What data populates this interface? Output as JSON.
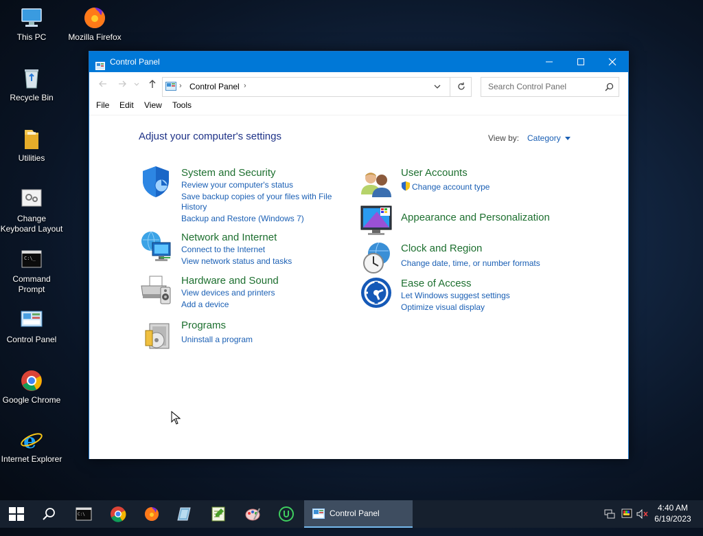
{
  "desktop": {
    "icons": [
      {
        "label": "This PC"
      },
      {
        "label": "Mozilla Firefox"
      },
      {
        "label": "Recycle Bin"
      },
      {
        "label": "Utilities"
      },
      {
        "label": "Change\nKeyboard Layout"
      },
      {
        "label": "Command\nPrompt"
      },
      {
        "label": "Control Panel"
      },
      {
        "label": "Google Chrome"
      },
      {
        "label": "Internet Explorer"
      }
    ]
  },
  "window": {
    "title": "Control Panel",
    "address": {
      "crumb": "Control Panel"
    },
    "search": {
      "placeholder": "Search Control Panel"
    },
    "menu": [
      "File",
      "Edit",
      "View",
      "Tools"
    ]
  },
  "content": {
    "heading": "Adjust your computer's settings",
    "view_by_label": "View by:",
    "view_by_value": "Category",
    "categories": [
      {
        "title": "System and Security",
        "links": [
          "Review your computer's status",
          "Save backup copies of your files with File",
          "History",
          "Backup and Restore (Windows 7)"
        ]
      },
      {
        "title": "Network and Internet",
        "links": [
          "Connect to the Internet",
          "View network status and tasks"
        ]
      },
      {
        "title": "Hardware and Sound",
        "links": [
          "View devices and printers",
          "Add a device"
        ]
      },
      {
        "title": "Programs",
        "links": [
          "Uninstall a program"
        ]
      },
      {
        "title": "User Accounts",
        "links": [
          "Change account type"
        ]
      },
      {
        "title": "Appearance and Personalization",
        "links": []
      },
      {
        "title": "Clock and Region",
        "links": [
          "Change date, time, or number formats"
        ]
      },
      {
        "title": "Ease of Access",
        "links": [
          "Let Windows suggest settings",
          "Optimize visual display"
        ]
      }
    ]
  },
  "taskbar": {
    "active_app": "Control Panel",
    "clock_time": "4:40 AM",
    "clock_date": "6/19/2023"
  },
  "colors": {
    "titlebar": "#0078d7",
    "heading": "#1e3287",
    "category_title": "#1d6f2f",
    "link": "#1a5fb4",
    "taskbar": "#16202e"
  }
}
